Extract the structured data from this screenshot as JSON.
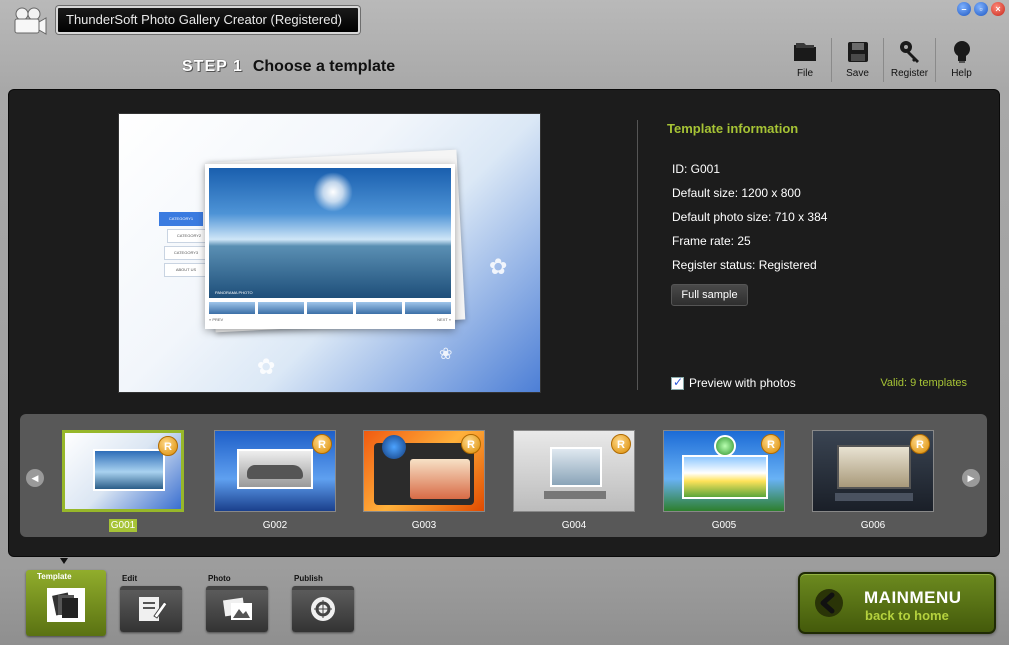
{
  "window": {
    "title": "ThunderSoft Photo Gallery Creator (Registered)"
  },
  "step": {
    "number": "STEP 1",
    "title": "Choose a template"
  },
  "toolbar": {
    "items": [
      {
        "label": "File",
        "icon": "folder-icon"
      },
      {
        "label": "Save",
        "icon": "floppy-disk-icon"
      },
      {
        "label": "Register",
        "icon": "key-icon"
      },
      {
        "label": "Help",
        "icon": "lightbulb-icon"
      }
    ]
  },
  "preview": {
    "menu_items": [
      "CATEGORY1",
      "CATEGORY2",
      "CATEGORY3",
      "ABOUT US"
    ],
    "caption": "PANORAMA PHOTO",
    "pager_prev": "« PREV",
    "pager_next": "NEXT »"
  },
  "template_info": {
    "title": "Template information",
    "id": "ID: G001",
    "default_size": "Default size: 1200 x 800",
    "default_photo_size": "Default photo size: 710 x 384",
    "frame_rate": "Frame rate: 25",
    "register_status": "Register status: Registered",
    "full_sample_label": "Full sample",
    "preview_with_photos_label": "Preview with photos",
    "preview_with_photos_checked": true,
    "valid_count": "Valid: 9 templates"
  },
  "templates": [
    {
      "name": "G001",
      "selected": true,
      "badge": "R"
    },
    {
      "name": "G002",
      "selected": false,
      "badge": "R"
    },
    {
      "name": "G003",
      "selected": false,
      "badge": "R"
    },
    {
      "name": "G004",
      "selected": false,
      "badge": "R"
    },
    {
      "name": "G005",
      "selected": false,
      "badge": "R"
    },
    {
      "name": "G006",
      "selected": false,
      "badge": "R"
    }
  ],
  "nav": {
    "items": [
      {
        "label": "Template",
        "active": true
      },
      {
        "label": "Edit",
        "active": false
      },
      {
        "label": "Photo",
        "active": false
      },
      {
        "label": "Publish",
        "active": false
      }
    ]
  },
  "mainmenu": {
    "title": "MAINMENU",
    "subtitle": "back to home"
  },
  "colors": {
    "accent_green": "#a6c335",
    "panel_dark": "#1c1c1c",
    "strip_gray": "#585858"
  }
}
